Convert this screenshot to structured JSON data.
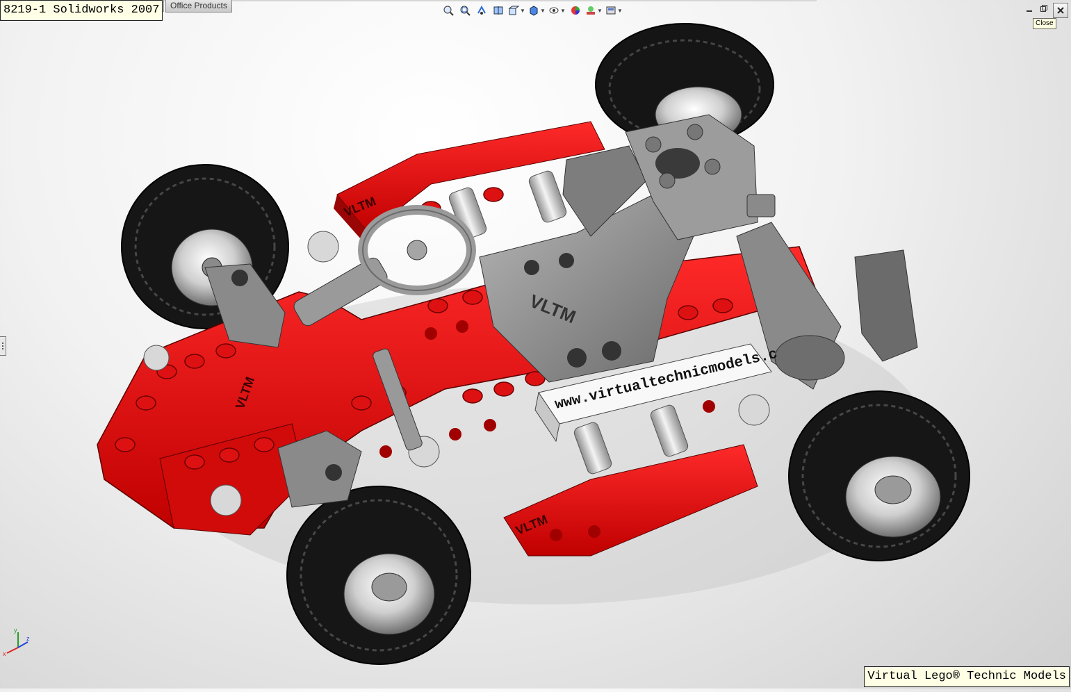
{
  "window": {
    "title_label": "8219-1 Solidworks 2007",
    "tab_label": "Office Products",
    "close_tooltip": "Close"
  },
  "toolbar": {
    "icons": [
      "zoom-to-fit-icon",
      "zoom-to-area-icon",
      "previous-view-icon",
      "section-view-icon",
      "view-orientation-icon",
      "display-style-icon",
      "hide-show-items-icon",
      "edit-appearance-icon",
      "apply-scene-icon",
      "view-settings-icon"
    ]
  },
  "model": {
    "decal_text": "www.virtualtechnicmodels.c",
    "part_logo": "VLTM",
    "colors": {
      "chassis_red": "#e00d0d",
      "dark_red": "#9a0505",
      "part_gray": "#8a8a8a",
      "tire_black": "#1c1c1c",
      "rim_silver": "#d6d6d6"
    }
  },
  "triad": {
    "x": "x",
    "y": "y",
    "z": "z"
  },
  "footer": {
    "watermark": "Virtual Lego® Technic Models"
  }
}
